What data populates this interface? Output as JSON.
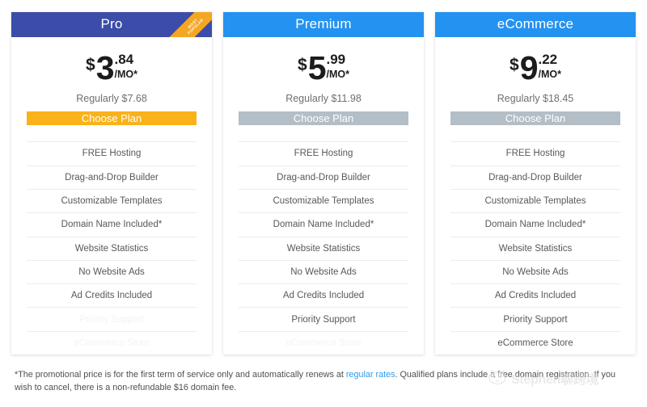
{
  "plans": [
    {
      "name": "Pro",
      "header_color": "#3b4da8",
      "most_popular": true,
      "ribbon_label": "MOST\nPOPULAR",
      "currency": "$",
      "price_whole": "3",
      "price_cents": ".84",
      "price_period": "/MO*",
      "regular_price": "Regularly $7.68",
      "cta_label": "Choose Plan",
      "cta_style": "primary",
      "cta_color": "#f9b21a",
      "features": [
        {
          "label": "FREE Hosting",
          "included": true
        },
        {
          "label": "Drag-and-Drop Builder",
          "included": true
        },
        {
          "label": "Customizable Templates",
          "included": true
        },
        {
          "label": "Domain Name Included*",
          "included": true
        },
        {
          "label": "Website Statistics",
          "included": true
        },
        {
          "label": "No Website Ads",
          "included": true
        },
        {
          "label": "Ad Credits Included",
          "included": true
        },
        {
          "label": "Priority Support",
          "included": false
        },
        {
          "label": "eCommerce Store",
          "included": false
        }
      ]
    },
    {
      "name": "Premium",
      "header_color": "#2492f0",
      "most_popular": false,
      "ribbon_label": "",
      "currency": "$",
      "price_whole": "5",
      "price_cents": ".99",
      "price_period": "/MO*",
      "regular_price": "Regularly $11.98",
      "cta_label": "Choose Plan",
      "cta_style": "muted",
      "cta_color": "#b3bec6",
      "features": [
        {
          "label": "FREE Hosting",
          "included": true
        },
        {
          "label": "Drag-and-Drop Builder",
          "included": true
        },
        {
          "label": "Customizable Templates",
          "included": true
        },
        {
          "label": "Domain Name Included*",
          "included": true
        },
        {
          "label": "Website Statistics",
          "included": true
        },
        {
          "label": "No Website Ads",
          "included": true
        },
        {
          "label": "Ad Credits Included",
          "included": true
        },
        {
          "label": "Priority Support",
          "included": true
        },
        {
          "label": "eCommerce Store",
          "included": false
        }
      ]
    },
    {
      "name": "eCommerce",
      "header_color": "#2492f0",
      "most_popular": false,
      "ribbon_label": "",
      "currency": "$",
      "price_whole": "9",
      "price_cents": ".22",
      "price_period": "/MO*",
      "regular_price": "Regularly $18.45",
      "cta_label": "Choose Plan",
      "cta_style": "muted",
      "cta_color": "#b3bec6",
      "features": [
        {
          "label": "FREE Hosting",
          "included": true
        },
        {
          "label": "Drag-and-Drop Builder",
          "included": true
        },
        {
          "label": "Customizable Templates",
          "included": true
        },
        {
          "label": "Domain Name Included*",
          "included": true
        },
        {
          "label": "Website Statistics",
          "included": true
        },
        {
          "label": "No Website Ads",
          "included": true
        },
        {
          "label": "Ad Credits Included",
          "included": true
        },
        {
          "label": "Priority Support",
          "included": true
        },
        {
          "label": "eCommerce Store",
          "included": true
        }
      ]
    }
  ],
  "footnote": {
    "part1": "*The promotional price is for the first term of service only and automatically renews at ",
    "link_text": "regular rates",
    "part2": ". Qualified plans include a free domain registration. If you wish to cancel, there is a non-refundable $16 domain fee.",
    "link_color": "#2e9bea"
  },
  "watermark": {
    "text": "Stephen聊跨境",
    "icon": "cat-face-icon"
  }
}
